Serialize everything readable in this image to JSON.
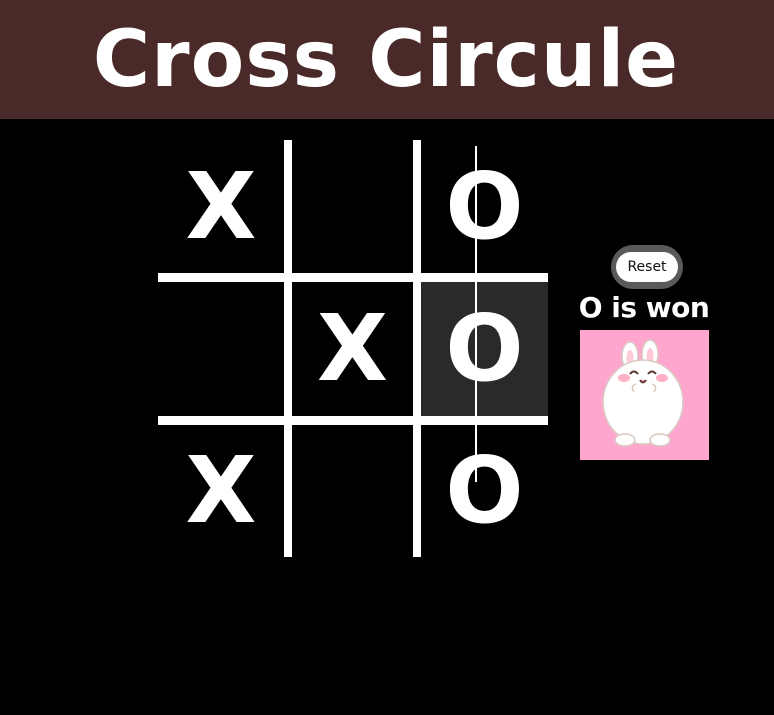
{
  "header": {
    "title": "Cross Circule"
  },
  "board": {
    "cells": [
      {
        "mark": "X",
        "highlighted": false
      },
      {
        "mark": "",
        "highlighted": false
      },
      {
        "mark": "O",
        "highlighted": false
      },
      {
        "mark": "",
        "highlighted": false
      },
      {
        "mark": "X",
        "highlighted": false
      },
      {
        "mark": "O",
        "highlighted": true
      },
      {
        "mark": "X",
        "highlighted": false
      },
      {
        "mark": "",
        "highlighted": false
      },
      {
        "mark": "O",
        "highlighted": false
      }
    ],
    "winning_column": 3
  },
  "sidebar": {
    "reset_label": "Reset",
    "status_text": "O is won"
  },
  "colors": {
    "header_bg": "#4a2a28",
    "board_bg": "#000000",
    "highlight": "#2a2a2a",
    "image_bg": "#ffa6cf",
    "mark": "#ffffff"
  },
  "icons": {
    "winner_image": "happy-bunny-icon"
  }
}
